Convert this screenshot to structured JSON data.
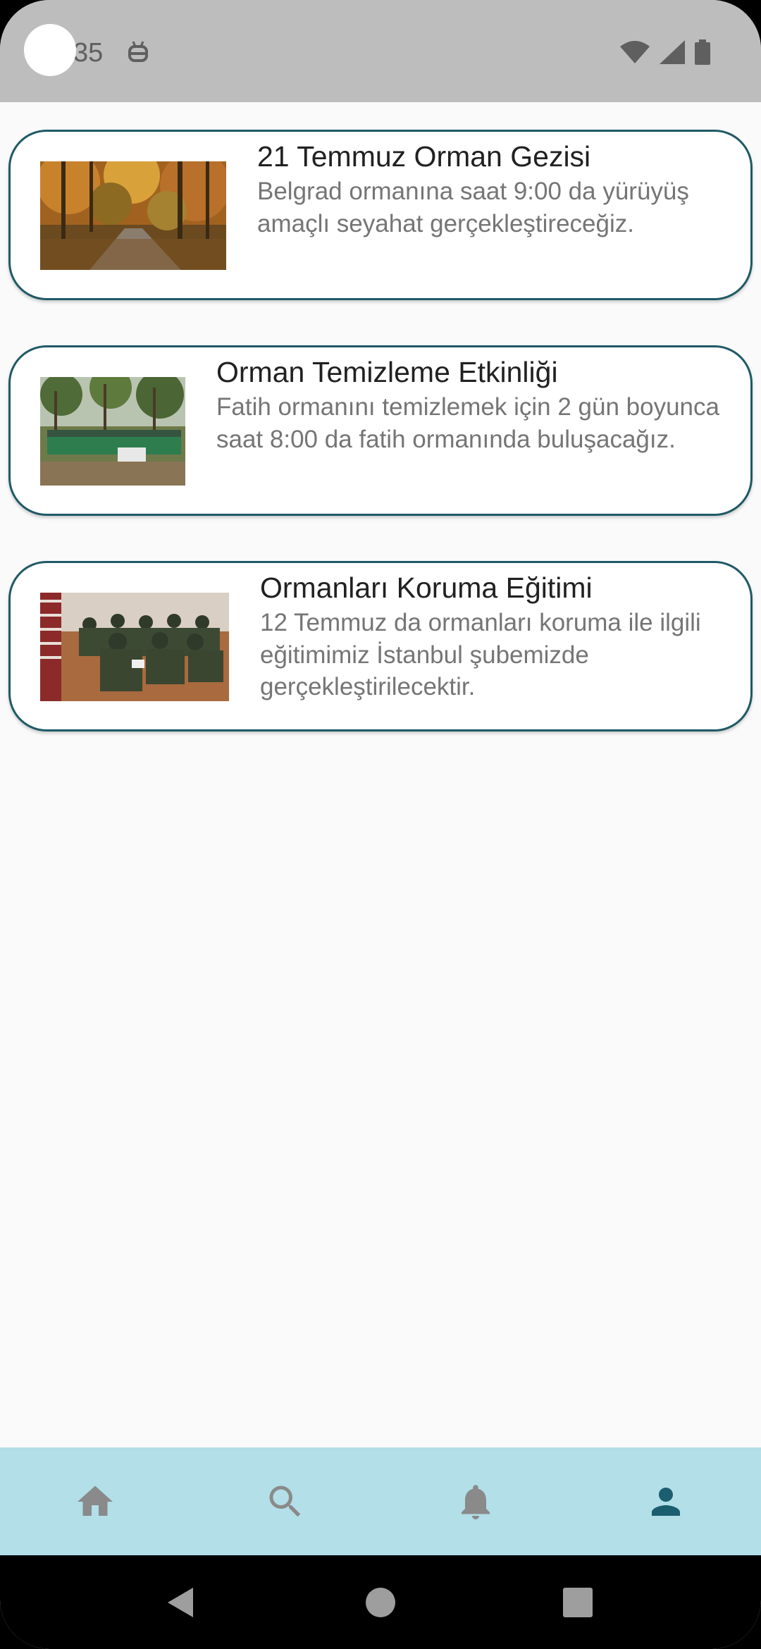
{
  "status_bar": {
    "time": "35"
  },
  "events": [
    {
      "title": "21 Temmuz Orman Gezisi",
      "description": "Belgrad ormanına saat 9:00 da yürüyüş amaçlı seyahat gerçekleştireceğiz."
    },
    {
      "title": "Orman Temizleme Etkinliği",
      "description": "Fatih ormanını temizlemek için 2 gün boyunca saat 8:00 da fatih ormanında buluşacağız."
    },
    {
      "title": "Ormanları Koruma Eğitimi",
      "description": "12 Temmuz da ormanları koruma ile ilgili eğitimimiz İstanbul şubemizde gerçekleştirilecektir."
    }
  ],
  "bottom_nav": {
    "items": [
      {
        "icon": "home-icon",
        "active": false
      },
      {
        "icon": "search-icon",
        "active": false
      },
      {
        "icon": "bell-icon",
        "active": false
      },
      {
        "icon": "person-icon",
        "active": true
      }
    ],
    "active_color": "#1b5e6f",
    "inactive_color": "#8a8a8a"
  },
  "colors": {
    "card_border": "#1f5a66",
    "status_bar": "#bdbdbd",
    "nav_background": "#b2dfe8"
  }
}
